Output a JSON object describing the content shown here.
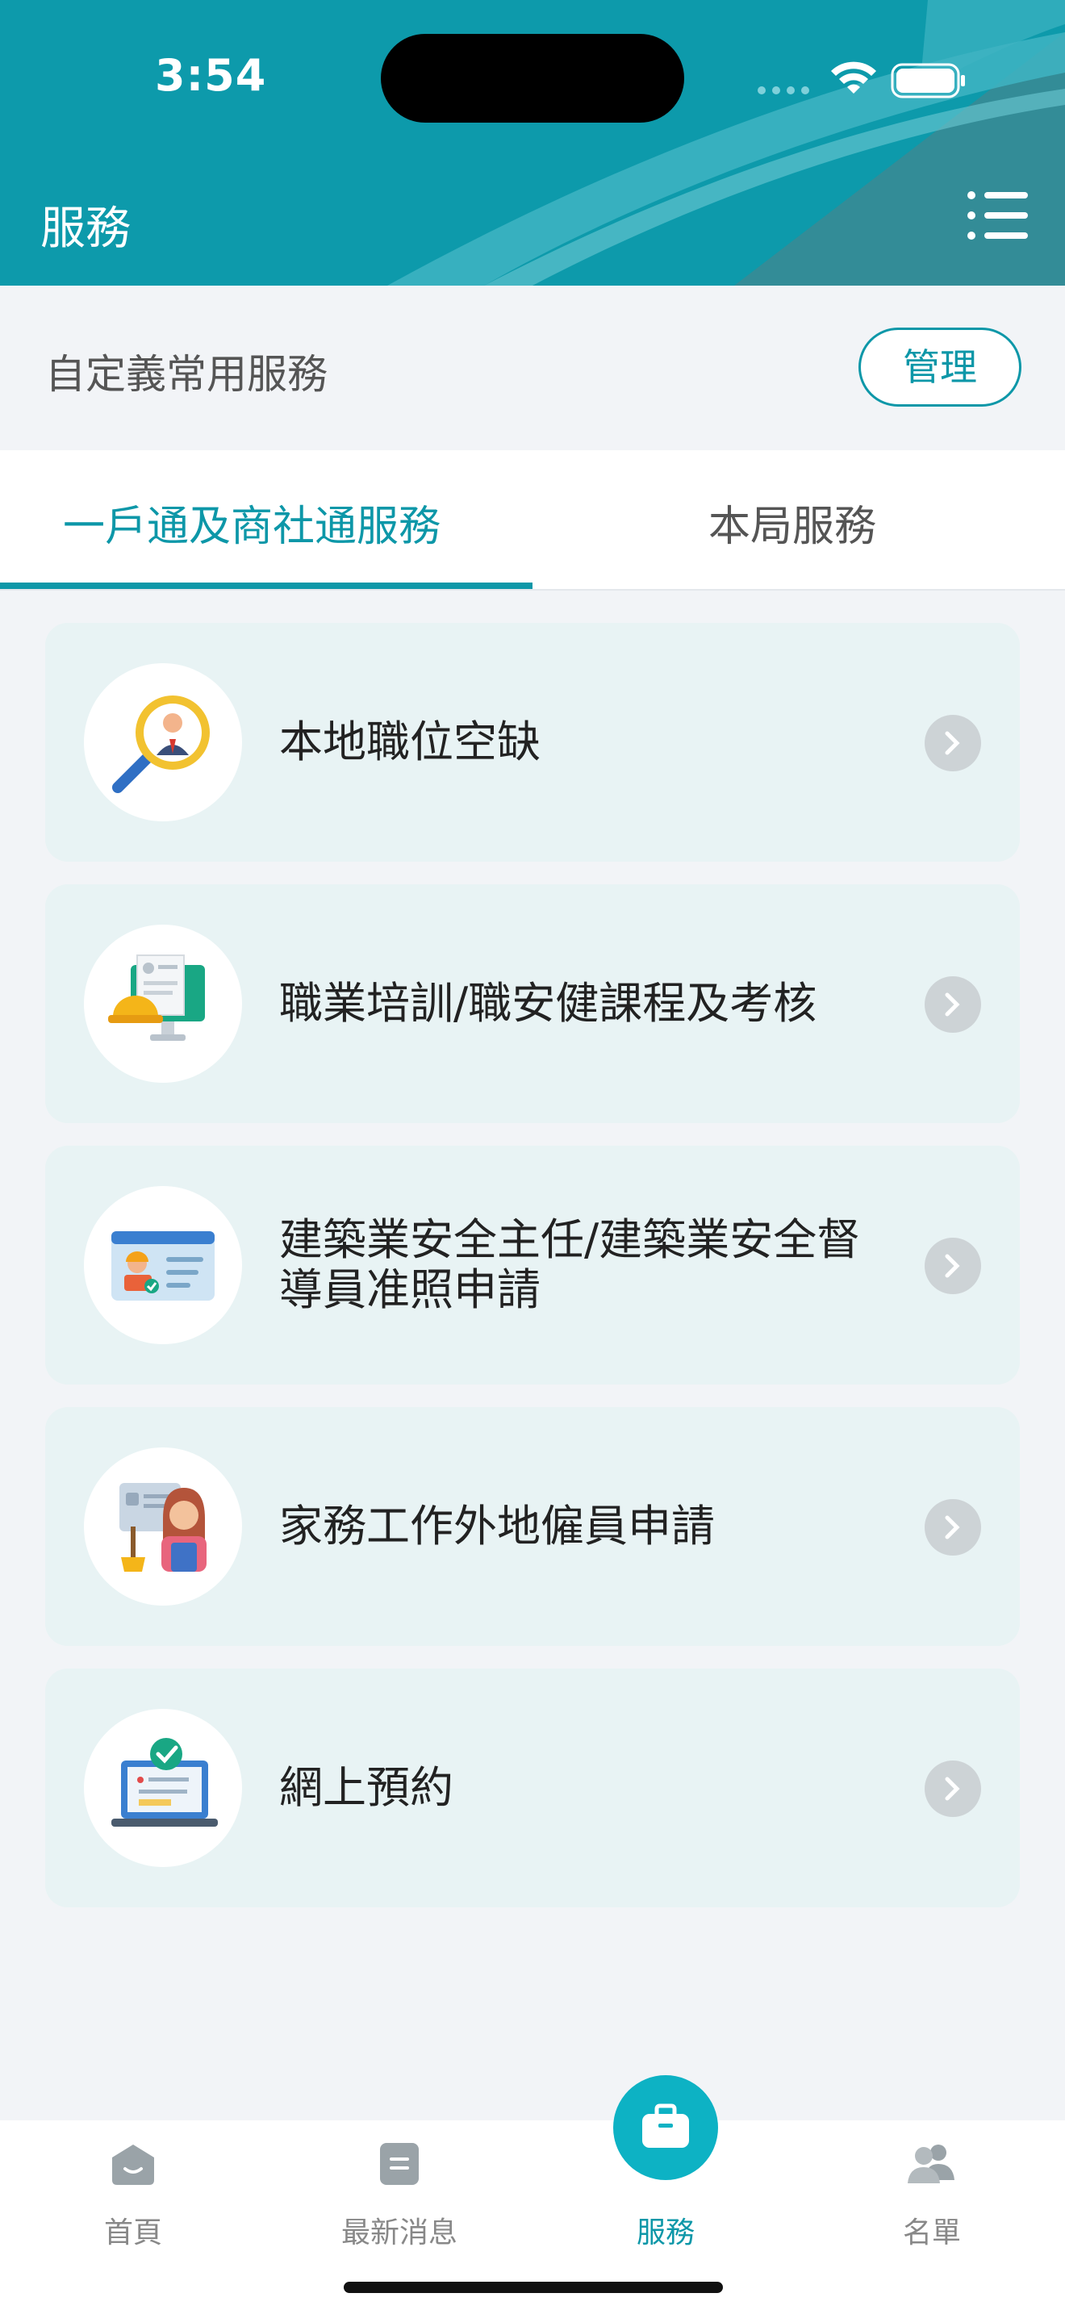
{
  "status_bar": {
    "time": "3:54"
  },
  "header": {
    "title": "服務",
    "menu_icon": "list-menu-icon"
  },
  "custom_services": {
    "label": "自定義常用服務",
    "manage_button": "管理"
  },
  "tabs": [
    {
      "label": "一戶通及商社通服務",
      "active": true
    },
    {
      "label": "本局服務",
      "active": false
    }
  ],
  "services": [
    {
      "label": "本地職位空缺",
      "icon": "job-search-icon"
    },
    {
      "label": "職業培訓/職安健課程及考核",
      "icon": "training-monitor-icon"
    },
    {
      "label_line1": "建築業安全主任/建築業安全督",
      "label_line2": "導員准照申請",
      "icon": "worker-license-icon"
    },
    {
      "label": "家務工作外地僱員申請",
      "icon": "domestic-helper-icon"
    },
    {
      "label": "網上預約",
      "icon": "online-booking-icon"
    }
  ],
  "bottom_nav": [
    {
      "label": "首頁",
      "icon": "home-icon",
      "active": false
    },
    {
      "label": "最新消息",
      "icon": "news-icon",
      "active": false
    },
    {
      "label": "服務",
      "icon": "briefcase-icon",
      "active": true
    },
    {
      "label": "名單",
      "icon": "people-icon",
      "active": false
    }
  ],
  "colors": {
    "primary": "#0d97a8",
    "card_bg": "#e8f3f4",
    "page_bg": "#f2f4f7"
  }
}
